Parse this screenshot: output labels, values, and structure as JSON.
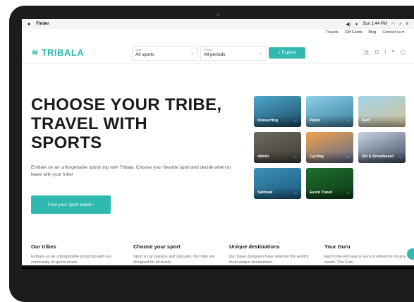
{
  "menubar": {
    "apple_icon": "",
    "app_name": "Finder",
    "status": "Sun 1:44 PM"
  },
  "topnav": {
    "items": [
      "Travels",
      "Gift Cards",
      "Blog",
      "Contact us ▾"
    ]
  },
  "header": {
    "logo": "TRIBALA",
    "sport_select": {
      "label": "Sport",
      "value": "All sports"
    },
    "period_select": {
      "label": "Period",
      "value": "All periods"
    },
    "explore_label": "Explore"
  },
  "hero": {
    "title_lines": [
      "CHOOSE YOUR TRIBE,",
      "TRAVEL WITH",
      "SPORTS"
    ],
    "subtitle": "Embark on an unforgettable sports trip with Tribala. Choose your favorite sport and decide when to leave with your tribe!",
    "cta": "Find your sport travel ›"
  },
  "tiles": [
    {
      "label": "Kitesurfing",
      "colors": [
        "#4fa7c9",
        "#1b4a68"
      ]
    },
    {
      "label": "Padel",
      "colors": [
        "#8fd0ea",
        "#3a7f9c"
      ]
    },
    {
      "label": "Surf",
      "colors": [
        "#9fd3e8",
        "#d9c39a"
      ]
    },
    {
      "label": "eMoto",
      "colors": [
        "#6e6a5f",
        "#3f3c36"
      ]
    },
    {
      "label": "Cycling",
      "colors": [
        "#f2a24a",
        "#5b6a8c"
      ]
    },
    {
      "label": "Ski & Snowboard",
      "colors": [
        "#c9d4e0",
        "#3c4b62"
      ]
    },
    {
      "label": "Sailboat",
      "colors": [
        "#3f8fb5",
        "#1a5a7e"
      ]
    },
    {
      "label": "Event Travel",
      "colors": [
        "#1f6e2e",
        "#0e3a18"
      ]
    }
  ],
  "features": [
    {
      "title": "Our tribes",
      "text": "Embark on an unforgettable group trip with our community of sports lovers."
    },
    {
      "title": "Choose your sport",
      "text": "Sport is our passion and specialty. Our trips are designed for all levels."
    },
    {
      "title": "Unique destinations",
      "text": "Our travel designers have selected the world's most unique destinations."
    },
    {
      "title": "Your Guru",
      "text": "Each tribe will have a Guru of reference for any needs. The Guru"
    }
  ],
  "colors": {
    "accent": "#2fb9b0",
    "text": "#1b1b1b"
  }
}
